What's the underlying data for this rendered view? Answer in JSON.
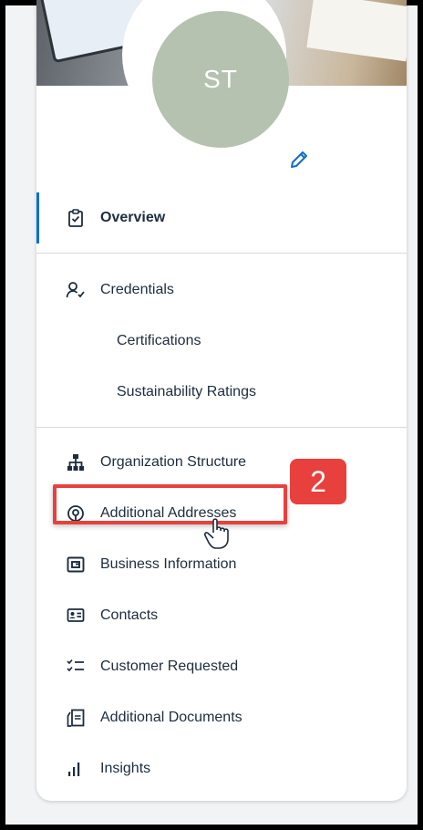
{
  "profile": {
    "initials": "ST",
    "avatar_color": "#b5c2af"
  },
  "nav": {
    "overview": {
      "label": "Overview",
      "icon": "clipboard-check-icon",
      "active": true
    },
    "credentials": {
      "label": "Credentials",
      "icon": "user-check-icon"
    },
    "certifications": {
      "label": "Certifications"
    },
    "sustainability": {
      "label": "Sustainability Ratings"
    },
    "org_structure": {
      "label": "Organization Structure",
      "icon": "org-chart-icon"
    },
    "additional_addresses": {
      "label": "Additional Addresses",
      "icon": "location-pin-icon"
    },
    "business_information": {
      "label": "Business Information",
      "icon": "wallet-icon"
    },
    "contacts": {
      "label": "Contacts",
      "icon": "contact-card-icon"
    },
    "customer_requested": {
      "label": "Customer Requested",
      "icon": "checklist-icon"
    },
    "additional_documents": {
      "label": "Additional Documents",
      "icon": "documents-icon"
    },
    "insights": {
      "label": "Insights",
      "icon": "bar-chart-icon"
    }
  },
  "annotation": {
    "step_number": "2",
    "color": "#e8403d"
  },
  "accent_color": "#0a6ed1"
}
